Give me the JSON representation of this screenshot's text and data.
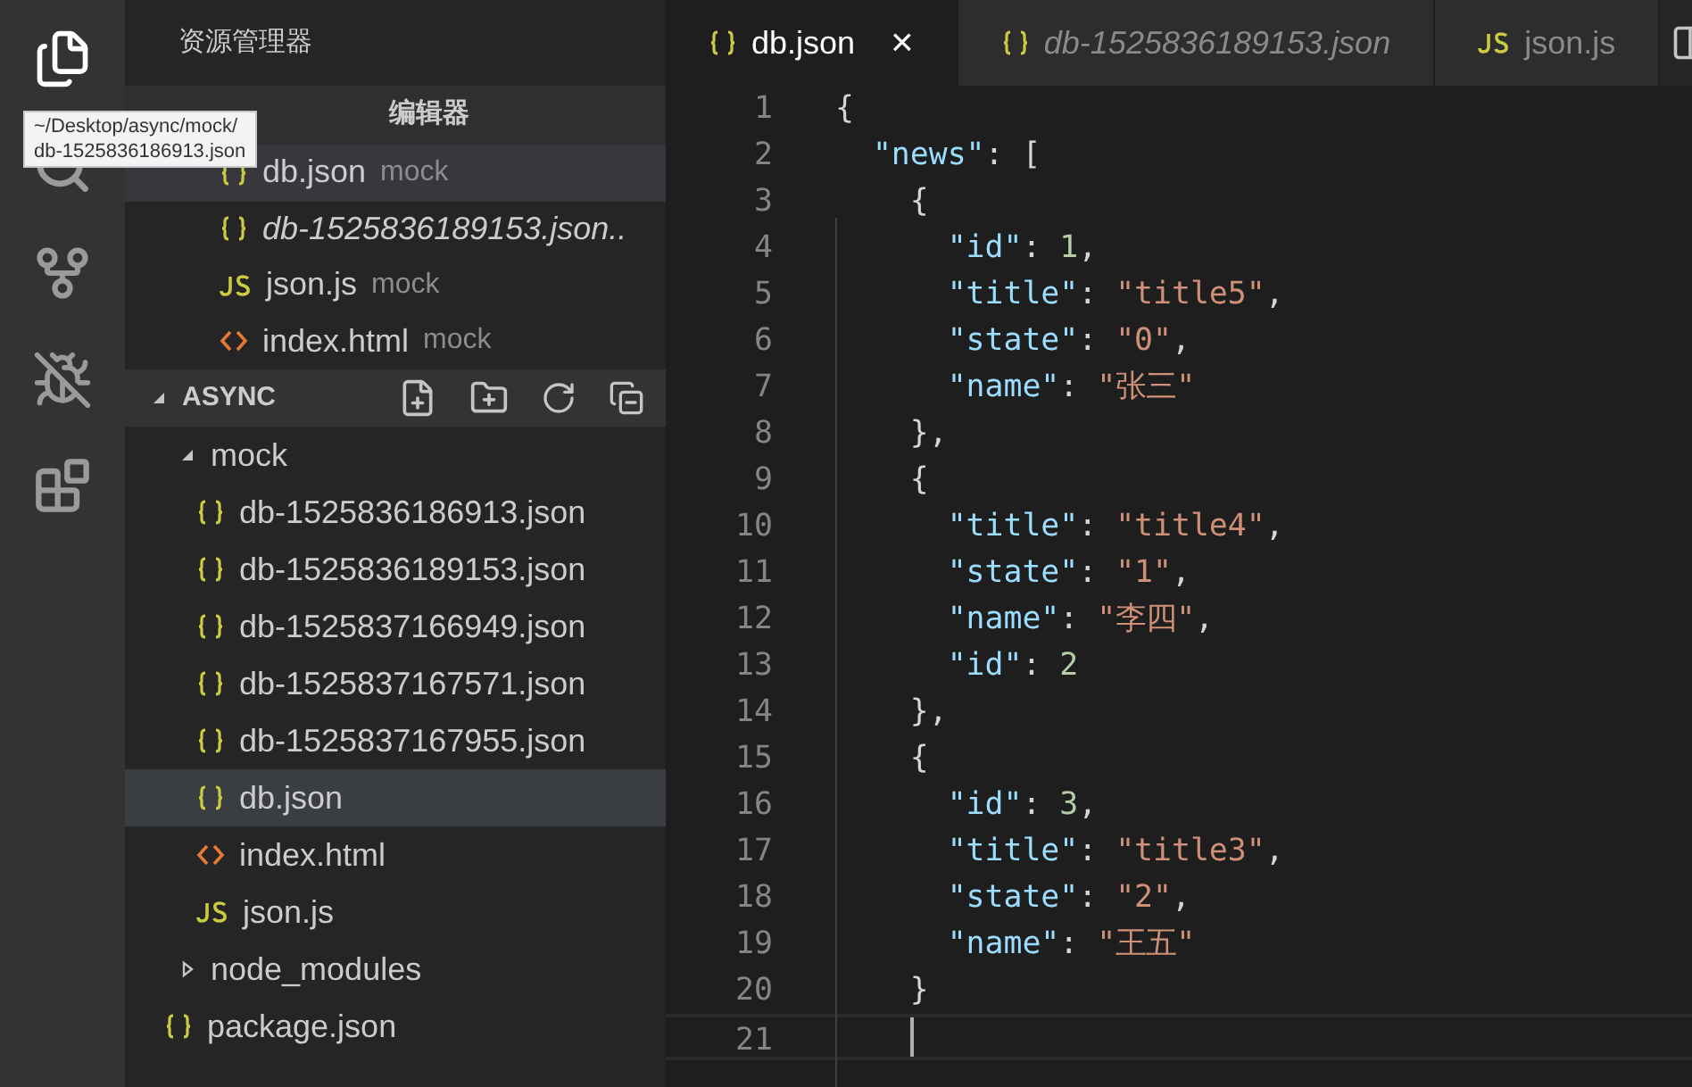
{
  "sidebar": {
    "title": "资源管理器",
    "open_editors": {
      "title": "编辑器",
      "items": [
        {
          "kind": "json",
          "name": "db.json",
          "description": "mock",
          "italic": false,
          "selected": true
        },
        {
          "kind": "json",
          "name": "db-1525836189153.json..",
          "italic": true,
          "selected": false
        },
        {
          "kind": "js",
          "name": "json.js",
          "description": "mock",
          "italic": false,
          "selected": false
        },
        {
          "kind": "html",
          "name": "index.html",
          "description": "mock",
          "italic": false,
          "selected": false
        }
      ]
    },
    "folder": {
      "title": "ASYNC",
      "expanded": true,
      "tree": [
        {
          "kind": "folder",
          "name": "mock",
          "expanded": true,
          "selected": false,
          "children": [
            {
              "kind": "json",
              "name": "db-1525836186913.json",
              "selected": false
            },
            {
              "kind": "json",
              "name": "db-1525836189153.json",
              "selected": false
            },
            {
              "kind": "json",
              "name": "db-1525837166949.json",
              "selected": false
            },
            {
              "kind": "json",
              "name": "db-1525837167571.json",
              "selected": false
            },
            {
              "kind": "json",
              "name": "db-1525837167955.json",
              "selected": false
            },
            {
              "kind": "json",
              "name": "db.json",
              "selected": true
            },
            {
              "kind": "html",
              "name": "index.html",
              "selected": false
            },
            {
              "kind": "js",
              "name": "json.js",
              "selected": false
            }
          ]
        },
        {
          "kind": "folder",
          "name": "node_modules",
          "expanded": false,
          "selected": false
        },
        {
          "kind": "json",
          "name": "package.json",
          "selected": false
        }
      ]
    }
  },
  "tooltip": {
    "lines": [
      "~/Desktop/async/mock/",
      "db-1525836186913.json"
    ]
  },
  "tabs": [
    {
      "kind": "json",
      "label": "db.json",
      "italic": false,
      "selected": true,
      "close": "×"
    },
    {
      "kind": "json",
      "label": "db-1525836189153.json",
      "italic": true,
      "selected": false
    },
    {
      "kind": "js",
      "label": "json.js",
      "italic": false,
      "selected": false
    }
  ],
  "editor": {
    "lines": [
      {
        "number": "1",
        "current": false,
        "tokens": [
          {
            "kind": "punct",
            "text": "{"
          }
        ]
      },
      {
        "number": "2",
        "current": false,
        "tokens": [
          {
            "kind": "key",
            "text": "  \"news\""
          },
          {
            "kind": "punct",
            "text": ": ["
          }
        ]
      },
      {
        "number": "3",
        "current": false,
        "tokens": [
          {
            "kind": "punct",
            "text": "    {"
          }
        ]
      },
      {
        "number": "4",
        "current": false,
        "tokens": [
          {
            "kind": "key",
            "text": "      \"id\""
          },
          {
            "kind": "punct",
            "text": ": "
          },
          {
            "kind": "number",
            "text": "1"
          },
          {
            "kind": "punct",
            "text": ","
          }
        ]
      },
      {
        "number": "5",
        "current": false,
        "tokens": [
          {
            "kind": "key",
            "text": "      \"title\""
          },
          {
            "kind": "punct",
            "text": ": "
          },
          {
            "kind": "string",
            "text": "\"title5\""
          },
          {
            "kind": "punct",
            "text": ","
          }
        ]
      },
      {
        "number": "6",
        "current": false,
        "tokens": [
          {
            "kind": "key",
            "text": "      \"state\""
          },
          {
            "kind": "punct",
            "text": ": "
          },
          {
            "kind": "string",
            "text": "\"0\""
          },
          {
            "kind": "punct",
            "text": ","
          }
        ]
      },
      {
        "number": "7",
        "current": false,
        "tokens": [
          {
            "kind": "key",
            "text": "      \"name\""
          },
          {
            "kind": "punct",
            "text": ": "
          },
          {
            "kind": "string",
            "text": "\"张三\""
          }
        ]
      },
      {
        "number": "8",
        "current": false,
        "tokens": [
          {
            "kind": "punct",
            "text": "    },"
          }
        ]
      },
      {
        "number": "9",
        "current": false,
        "tokens": [
          {
            "kind": "punct",
            "text": "    {"
          }
        ]
      },
      {
        "number": "10",
        "current": false,
        "tokens": [
          {
            "kind": "key",
            "text": "      \"title\""
          },
          {
            "kind": "punct",
            "text": ": "
          },
          {
            "kind": "string",
            "text": "\"title4\""
          },
          {
            "kind": "punct",
            "text": ","
          }
        ]
      },
      {
        "number": "11",
        "current": false,
        "tokens": [
          {
            "kind": "key",
            "text": "      \"state\""
          },
          {
            "kind": "punct",
            "text": ": "
          },
          {
            "kind": "string",
            "text": "\"1\""
          },
          {
            "kind": "punct",
            "text": ","
          }
        ]
      },
      {
        "number": "12",
        "current": false,
        "tokens": [
          {
            "kind": "key",
            "text": "      \"name\""
          },
          {
            "kind": "punct",
            "text": ": "
          },
          {
            "kind": "string",
            "text": "\"李四\""
          },
          {
            "kind": "punct",
            "text": ","
          }
        ]
      },
      {
        "number": "13",
        "current": false,
        "tokens": [
          {
            "kind": "key",
            "text": "      \"id\""
          },
          {
            "kind": "punct",
            "text": ": "
          },
          {
            "kind": "number",
            "text": "2"
          }
        ]
      },
      {
        "number": "14",
        "current": false,
        "tokens": [
          {
            "kind": "punct",
            "text": "    },"
          }
        ]
      },
      {
        "number": "15",
        "current": false,
        "tokens": [
          {
            "kind": "punct",
            "text": "    {"
          }
        ]
      },
      {
        "number": "16",
        "current": false,
        "tokens": [
          {
            "kind": "key",
            "text": "      \"id\""
          },
          {
            "kind": "punct",
            "text": ": "
          },
          {
            "kind": "number",
            "text": "3"
          },
          {
            "kind": "punct",
            "text": ","
          }
        ]
      },
      {
        "number": "17",
        "current": false,
        "tokens": [
          {
            "kind": "key",
            "text": "      \"title\""
          },
          {
            "kind": "punct",
            "text": ": "
          },
          {
            "kind": "string",
            "text": "\"title3\""
          },
          {
            "kind": "punct",
            "text": ","
          }
        ]
      },
      {
        "number": "18",
        "current": false,
        "tokens": [
          {
            "kind": "key",
            "text": "      \"state\""
          },
          {
            "kind": "punct",
            "text": ": "
          },
          {
            "kind": "string",
            "text": "\"2\""
          },
          {
            "kind": "punct",
            "text": ","
          }
        ]
      },
      {
        "number": "19",
        "current": false,
        "tokens": [
          {
            "kind": "key",
            "text": "      \"name\""
          },
          {
            "kind": "punct",
            "text": ": "
          },
          {
            "kind": "string",
            "text": "\"王五\""
          }
        ]
      },
      {
        "number": "20",
        "current": false,
        "tokens": [
          {
            "kind": "punct",
            "text": "    }"
          }
        ]
      },
      {
        "number": "21",
        "current": true
      }
    ]
  }
}
